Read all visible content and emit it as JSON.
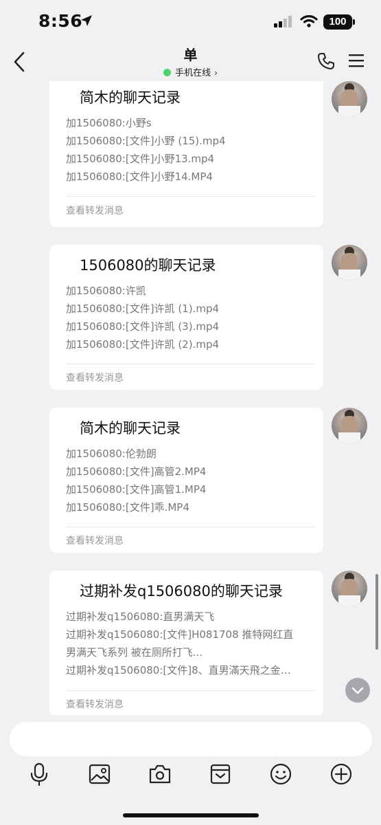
{
  "status": {
    "time": "8:56",
    "battery": "100"
  },
  "header": {
    "title": "单",
    "presence": "手机在线"
  },
  "messages": [
    {
      "title": "简木的聊天记录",
      "lines": [
        "加1506080:小野s",
        "加1506080:[文件]小野 (15).mp4",
        "加1506080:[文件]小野13.mp4",
        "加1506080:[文件]小野14.MP4"
      ],
      "footer": "查看转发消息"
    },
    {
      "title": "1506080的聊天记录",
      "lines": [
        "加1506080:许凯",
        "加1506080:[文件]许凯 (1).mp4",
        "加1506080:[文件]许凯 (3).mp4",
        "加1506080:[文件]许凯 (2).mp4"
      ],
      "footer": "查看转发消息"
    },
    {
      "title": "简木的聊天记录",
      "lines": [
        "加1506080:伦勃朗",
        "加1506080:[文件]高管2.MP4",
        "加1506080:[文件]高管1.MP4",
        "加1506080:[文件]乖.MP4"
      ],
      "footer": "查看转发消息"
    },
    {
      "title": "过期补发q1506080的聊天记录",
      "lines": [
        "过期补发q1506080:直男满天飞",
        "过期补发q1506080:[文件]H081708 推特网红直",
        "男满天飞系列 被在厕所打飞...",
        "过期补发q1506080:[文件]8、直男滿天飛之金…"
      ],
      "footer": "查看转发消息"
    }
  ],
  "input": {
    "placeholder": ""
  },
  "toolbar": {
    "icons": [
      "microphone-icon",
      "image-icon",
      "camera-icon",
      "folder-icon",
      "emoji-icon",
      "plus-icon"
    ]
  }
}
